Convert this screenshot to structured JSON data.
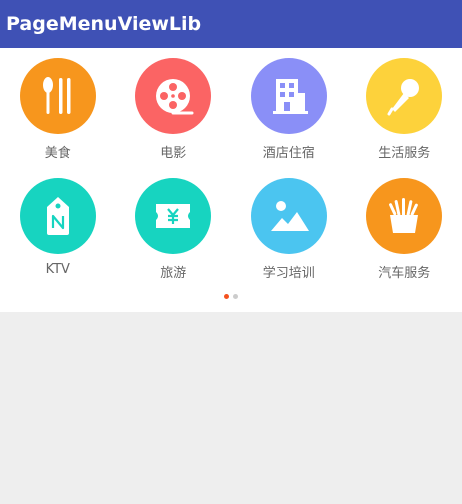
{
  "appbar": {
    "title": "PageMenuViewLib",
    "color": "#3f51b5"
  },
  "menu": {
    "items": [
      {
        "label": "美食",
        "icon": "utensils-icon",
        "color": "#f7961d"
      },
      {
        "label": "电影",
        "icon": "film-reel-icon",
        "color": "#fb6464"
      },
      {
        "label": "酒店住宿",
        "icon": "hotel-building-icon",
        "color": "#8a8ff7"
      },
      {
        "label": "生活服务",
        "icon": "microphone-icon",
        "color": "#fdd23b"
      },
      {
        "label": "KTV",
        "icon": "tag-icon",
        "color": "#17d4c0"
      },
      {
        "label": "旅游",
        "icon": "ticket-icon",
        "color": "#17d4c0"
      },
      {
        "label": "学习培训",
        "icon": "landscape-image-icon",
        "color": "#4bc5f0"
      },
      {
        "label": "汽车服务",
        "icon": "fries-icon",
        "color": "#f7961d"
      }
    ]
  },
  "pager": {
    "active_color": "#f4511e",
    "inactive_color": "#cccccc"
  }
}
